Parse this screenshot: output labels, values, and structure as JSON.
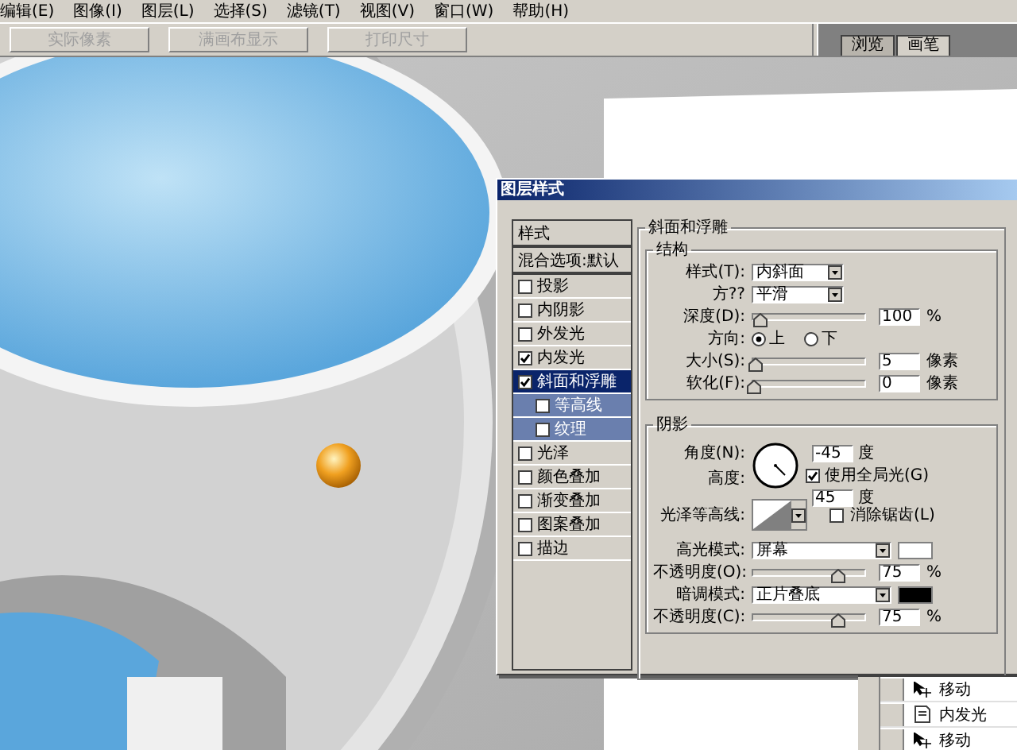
{
  "menu": [
    "编辑(E)",
    "图像(I)",
    "图层(L)",
    "选择(S)",
    "滤镜(T)",
    "视图(V)",
    "窗口(W)",
    "帮助(H)"
  ],
  "toolbar": {
    "buttons": [
      {
        "label": "实际像素",
        "disabled": true
      },
      {
        "label": "满画布显示",
        "disabled": true
      },
      {
        "label": "打印尺寸",
        "disabled": true
      }
    ]
  },
  "panel_tabs": [
    {
      "label": "浏览",
      "selected": false
    },
    {
      "label": "画笔",
      "selected": true
    }
  ],
  "dialog": {
    "title": "图层样式",
    "styles": [
      {
        "kind": "header",
        "label": "样式"
      },
      {
        "kind": "option",
        "label": "混合选项:默认"
      },
      {
        "kind": "effect",
        "label": "投影",
        "checked": false,
        "selected": false
      },
      {
        "kind": "effect",
        "label": "内阴影",
        "checked": false,
        "selected": false
      },
      {
        "kind": "effect",
        "label": "外发光",
        "checked": false,
        "selected": false
      },
      {
        "kind": "effect",
        "label": "内发光",
        "checked": true,
        "selected": false
      },
      {
        "kind": "effect",
        "label": "斜面和浮雕",
        "checked": true,
        "selected": true,
        "children": [
          {
            "label": "等高线",
            "checked": false
          },
          {
            "label": "纹理",
            "checked": false
          }
        ]
      },
      {
        "kind": "effect",
        "label": "光泽",
        "checked": false,
        "selected": false
      },
      {
        "kind": "effect",
        "label": "颜色叠加",
        "checked": false,
        "selected": false
      },
      {
        "kind": "effect",
        "label": "渐变叠加",
        "checked": false,
        "selected": false
      },
      {
        "kind": "effect",
        "label": "图案叠加",
        "checked": false,
        "selected": false
      },
      {
        "kind": "effect",
        "label": "描边",
        "checked": false,
        "selected": false
      }
    ],
    "section": {
      "title": "斜面和浮雕",
      "groups": [
        {
          "title": "结构",
          "rows": [
            {
              "kind": "select",
              "label": "样式(T):",
              "value": "内斜面"
            },
            {
              "kind": "select",
              "label": "方??",
              "value": "平滑"
            },
            {
              "kind": "slider",
              "label": "深度(D):",
              "level": 0.05,
              "value": "100",
              "unit": "%"
            },
            {
              "kind": "radio",
              "label": "方向:",
              "options": [
                {
                  "label": "上",
                  "selected": true
                },
                {
                  "label": "下",
                  "selected": false
                }
              ]
            },
            {
              "kind": "slider",
              "label": "大小(S):",
              "level": 0.02,
              "value": "5",
              "unit": "像素"
            },
            {
              "kind": "slider",
              "label": "软化(F):",
              "level": 0,
              "value": "0",
              "unit": "像素"
            }
          ]
        },
        {
          "title": "阴影",
          "rows": [
            {
              "kind": "angle",
              "label": "角度(N):",
              "value": "-45",
              "unit": "度",
              "check": {
                "label": "使用全局光(G)",
                "checked": true
              },
              "altitude": {
                "label": "高度:",
                "value": "45",
                "unit": "度"
              }
            },
            {
              "kind": "contour",
              "label": "光泽等高线:",
              "check": {
                "label": "消除锯齿(L)",
                "checked": false
              }
            },
            {
              "kind": "select",
              "label": "高光模式:",
              "value": "屏幕",
              "color": "#ffffff"
            },
            {
              "kind": "slider",
              "label": "不透明度(O):",
              "level": 0.75,
              "value": "75",
              "unit": "%"
            },
            {
              "kind": "select",
              "label": "暗调模式:",
              "value": "正片叠底",
              "color": "#000000"
            },
            {
              "kind": "slider",
              "label": "不透明度(C):",
              "level": 0.75,
              "value": "75",
              "unit": "%"
            }
          ]
        }
      ]
    }
  },
  "history": [
    {
      "kind": "move",
      "label": "移动"
    },
    {
      "kind": "style",
      "label": "内发光"
    },
    {
      "kind": "move",
      "label": "移动"
    }
  ]
}
